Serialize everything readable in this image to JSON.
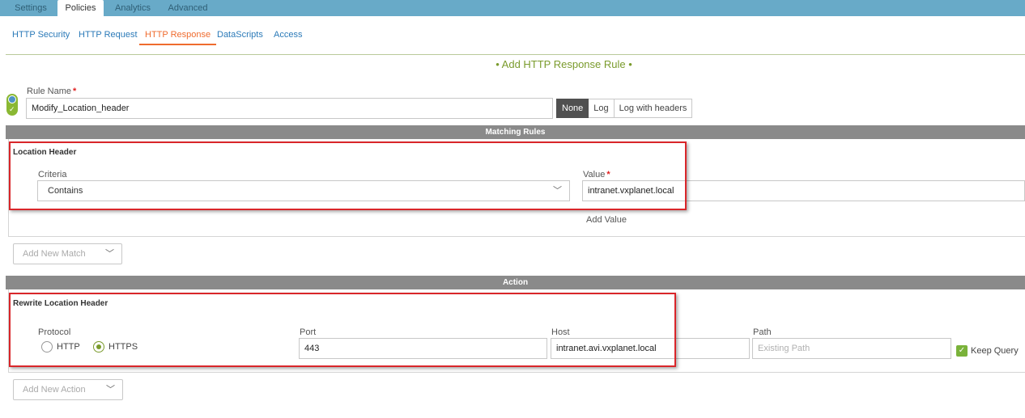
{
  "top_tabs": [
    "Settings",
    "Policies",
    "Analytics",
    "Advanced"
  ],
  "sub_tabs": [
    "HTTP Security",
    "HTTP Request",
    "HTTP Response",
    "DataScripts",
    "Access"
  ],
  "form": {
    "title": "• Add HTTP Response Rule •",
    "rule_name_label": "Rule Name",
    "required_mark": "*",
    "rule_name_value": "Modify_Location_header",
    "log_options": [
      "None",
      "Log",
      "Log with headers"
    ],
    "log_selected": "None"
  },
  "matching": {
    "section_title": "Matching Rules",
    "panel_title": "Location Header",
    "criteria_label": "Criteria",
    "criteria_value": "Contains",
    "value_label": "Value",
    "value_value": "intranet.vxplanet.local",
    "add_value_label": "Add Value",
    "add_new_match": "Add New Match"
  },
  "action": {
    "section_title": "Action",
    "panel_title": "Rewrite Location Header",
    "protocol_label": "Protocol",
    "protocol_options": [
      "HTTP",
      "HTTPS"
    ],
    "protocol_selected": "HTTPS",
    "port_label": "Port",
    "port_value": "443",
    "host_label": "Host",
    "host_value": "intranet.avi.vxplanet.local",
    "path_label": "Path",
    "path_placeholder": "Existing Path",
    "keep_query_label": "Keep Query",
    "keep_query_checked": true,
    "add_new_action": "Add New Action"
  },
  "colors": {
    "topbar": "#68aac8",
    "active_subtab": "#ef6b2e",
    "title_green": "#7a9b2c",
    "section_header": "#8a8a8a",
    "highlight": "#d9262a"
  }
}
